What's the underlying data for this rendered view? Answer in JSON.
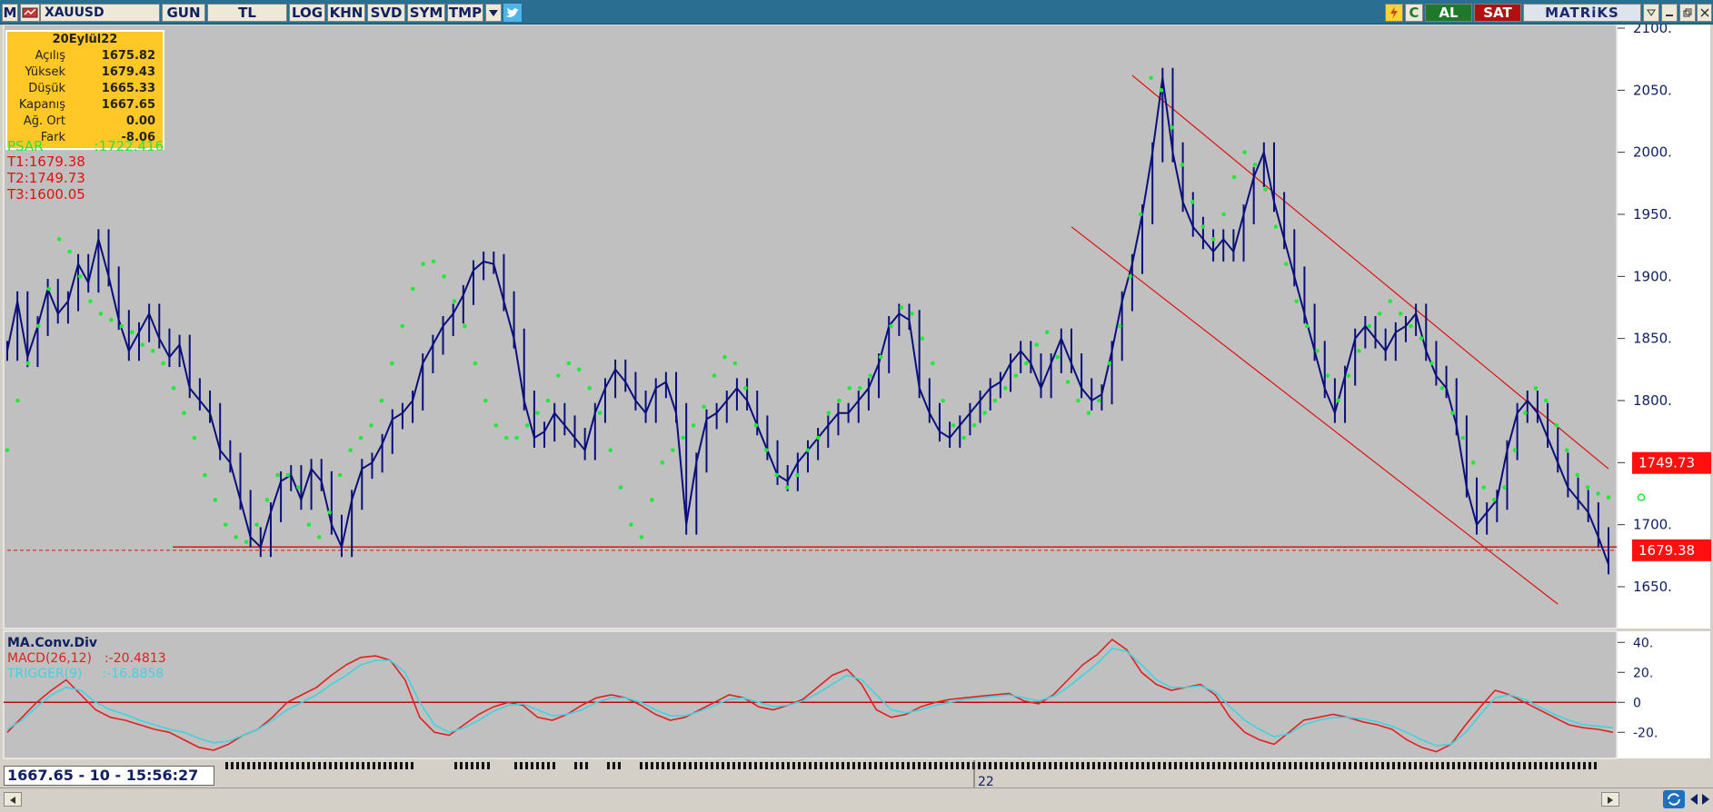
{
  "toolbar": {
    "logo": "M",
    "symbol": "XAUUSD",
    "buttons": [
      "GUN",
      "TL",
      "LOG",
      "KHN",
      "SVD",
      "SYM",
      "TMP"
    ],
    "right_buttons": {
      "c": "C",
      "al": "AL",
      "sat": "SAT"
    },
    "brand": "MATRiKS"
  },
  "ohlc": {
    "date": "20Eylül22",
    "rows": [
      {
        "label": "Açılış",
        "value": "1675.82"
      },
      {
        "label": "Yüksek",
        "value": "1679.43"
      },
      {
        "label": "Düşük",
        "value": "1665.33"
      },
      {
        "label": "Kapanış",
        "value": "1667.65"
      },
      {
        "label": "Ağ. Ort",
        "value": "0.00"
      },
      {
        "label": "Fark",
        "value": "-8.06"
      }
    ]
  },
  "psar": {
    "label": "PSAR",
    "value": ":1722.416"
  },
  "targets": [
    "T1:1679.38",
    "T2:1749.73",
    "T3:1600.05"
  ],
  "price_badges": [
    "1749.73",
    "1679.38"
  ],
  "macd_panel": {
    "title": "MA.Conv.Div",
    "macd_label": "MACD(26,12)",
    "macd_value": ":-20.4813",
    "trigger_label": "TRIGGER(9)",
    "trigger_value": ":-16.8858"
  },
  "x_axis": {
    "label": "22"
  },
  "status": {
    "readout": "1667.65 - 10 - 15:56:27"
  },
  "colors": {
    "price": "#0a0f7a",
    "psar": "#22e83a",
    "trend": "#e01010",
    "macd": "#e02020",
    "trigger": "#3fd3e0",
    "background": "#c0c0c0"
  },
  "chart_data": [
    {
      "type": "line",
      "title": "XAUUSD",
      "ylim": [
        1620,
        2100
      ],
      "y_ticks": [
        "2100.",
        "2050.",
        "2000.",
        "1950.",
        "1900.",
        "1850.",
        "1800.",
        "1750.",
        "1700.",
        "1650."
      ],
      "series": [
        {
          "name": "Price",
          "values": [
            1840,
            1880,
            1835,
            1860,
            1890,
            1870,
            1880,
            1910,
            1895,
            1930,
            1900,
            1865,
            1840,
            1855,
            1870,
            1850,
            1835,
            1845,
            1810,
            1800,
            1790,
            1760,
            1750,
            1720,
            1690,
            1682,
            1710,
            1735,
            1740,
            1720,
            1745,
            1735,
            1700,
            1682,
            1720,
            1745,
            1750,
            1765,
            1785,
            1790,
            1800,
            1830,
            1845,
            1860,
            1870,
            1885,
            1905,
            1912,
            1910,
            1880,
            1850,
            1800,
            1770,
            1775,
            1790,
            1780,
            1770,
            1760,
            1790,
            1810,
            1825,
            1815,
            1800,
            1790,
            1810,
            1815,
            1790,
            1700,
            1750,
            1785,
            1790,
            1800,
            1810,
            1800,
            1780,
            1760,
            1740,
            1735,
            1750,
            1760,
            1770,
            1780,
            1790,
            1790,
            1800,
            1810,
            1830,
            1860,
            1870,
            1865,
            1810,
            1790,
            1775,
            1770,
            1780,
            1790,
            1800,
            1810,
            1815,
            1830,
            1840,
            1830,
            1810,
            1830,
            1850,
            1830,
            1810,
            1800,
            1805,
            1840,
            1880,
            1910,
            1950,
            2000,
            2060,
            2000,
            1960,
            1940,
            1930,
            1920,
            1930,
            1920,
            1950,
            1980,
            2000,
            1960,
            1930,
            1900,
            1870,
            1840,
            1810,
            1790,
            1820,
            1850,
            1860,
            1850,
            1840,
            1855,
            1860,
            1870,
            1840,
            1820,
            1810,
            1780,
            1730,
            1700,
            1710,
            1720,
            1760,
            1790,
            1800,
            1790,
            1770,
            1750,
            1730,
            1720,
            1710,
            1690,
            1668
          ]
        },
        {
          "name": "PSAR",
          "values": [
            1760,
            1800,
            1830,
            1860,
            1890,
            1930,
            1920,
            1900,
            1880,
            1870,
            1865,
            1860,
            1855,
            1845,
            1840,
            1830,
            1810,
            1790,
            1770,
            1740,
            1720,
            1700,
            1690,
            1686,
            1700,
            1720,
            1740,
            1740,
            1730,
            1700,
            1690,
            1710,
            1740,
            1760,
            1770,
            1780,
            1800,
            1830,
            1860,
            1890,
            1910,
            1912,
            1900,
            1880,
            1860,
            1830,
            1800,
            1780,
            1770,
            1770,
            1780,
            1790,
            1800,
            1820,
            1830,
            1825,
            1810,
            1790,
            1760,
            1730,
            1700,
            1690,
            1720,
            1750,
            1760,
            1770,
            1780,
            1795,
            1820,
            1835,
            1830,
            1810,
            1780,
            1760,
            1740,
            1730,
            1740,
            1760,
            1770,
            1790,
            1800,
            1810,
            1810,
            1820,
            1835,
            1860,
            1875,
            1870,
            1850,
            1830,
            1800,
            1780,
            1770,
            1780,
            1790,
            1800,
            1810,
            1820,
            1830,
            1845,
            1855,
            1835,
            1815,
            1800,
            1790,
            1800,
            1830,
            1860,
            1900,
            1950,
            2060,
            2050,
            2020,
            1990,
            1960,
            1940,
            1930,
            1950,
            1980,
            2000,
            1990,
            1970,
            1940,
            1910,
            1880,
            1860,
            1840,
            1820,
            1800,
            1820,
            1840,
            1860,
            1870,
            1880,
            1870,
            1860,
            1850,
            1830,
            1810,
            1790,
            1770,
            1750,
            1730,
            1720,
            1730,
            1760,
            1790,
            1810,
            1800,
            1780,
            1760,
            1740,
            1730,
            1725,
            1722
          ]
        }
      ]
    },
    {
      "type": "line",
      "title": "MA.Conv.Div",
      "ylim": [
        -35,
        45
      ],
      "y_ticks": [
        "40.",
        "20.",
        "0",
        "-20."
      ],
      "series": [
        {
          "name": "MACD(26,12)",
          "values": [
            -20,
            -10,
            0,
            8,
            15,
            5,
            -5,
            -10,
            -12,
            -15,
            -18,
            -20,
            -25,
            -30,
            -32,
            -28,
            -22,
            -18,
            -10,
            0,
            5,
            10,
            18,
            25,
            30,
            31,
            28,
            15,
            -10,
            -20,
            -22,
            -15,
            -8,
            -3,
            0,
            -2,
            -10,
            -12,
            -8,
            -2,
            3,
            5,
            3,
            -2,
            -8,
            -12,
            -10,
            -5,
            0,
            5,
            3,
            -3,
            -5,
            -2,
            2,
            10,
            18,
            22,
            12,
            -5,
            -10,
            -8,
            -3,
            0,
            2,
            3,
            4,
            5,
            6,
            1,
            -1,
            5,
            15,
            25,
            32,
            42,
            35,
            20,
            12,
            8,
            10,
            12,
            5,
            -10,
            -20,
            -25,
            -28,
            -20,
            -12,
            -10,
            -8,
            -10,
            -13,
            -15,
            -18,
            -25,
            -30,
            -33,
            -28,
            -15,
            -3,
            8,
            5,
            0,
            -5,
            -10,
            -15,
            -17,
            -18,
            -20
          ]
        },
        {
          "name": "TRIGGER(9)",
          "values": [
            -18,
            -12,
            -3,
            5,
            10,
            8,
            0,
            -5,
            -8,
            -12,
            -15,
            -18,
            -20,
            -24,
            -27,
            -26,
            -22,
            -18,
            -12,
            -5,
            0,
            5,
            12,
            18,
            25,
            28,
            28,
            20,
            0,
            -15,
            -20,
            -17,
            -12,
            -6,
            -2,
            -1,
            -5,
            -9,
            -8,
            -5,
            0,
            3,
            3,
            0,
            -5,
            -9,
            -9,
            -6,
            -2,
            2,
            3,
            0,
            -3,
            -2,
            1,
            6,
            12,
            18,
            15,
            5,
            -5,
            -7,
            -5,
            -2,
            0,
            2,
            3,
            4,
            5,
            3,
            1,
            4,
            10,
            18,
            26,
            36,
            34,
            25,
            15,
            10,
            10,
            11,
            7,
            -3,
            -12,
            -18,
            -23,
            -21,
            -15,
            -12,
            -10,
            -10,
            -11,
            -13,
            -16,
            -20,
            -25,
            -29,
            -28,
            -20,
            -8,
            3,
            5,
            2,
            -3,
            -8,
            -12,
            -15,
            -16,
            -17
          ]
        }
      ]
    }
  ]
}
